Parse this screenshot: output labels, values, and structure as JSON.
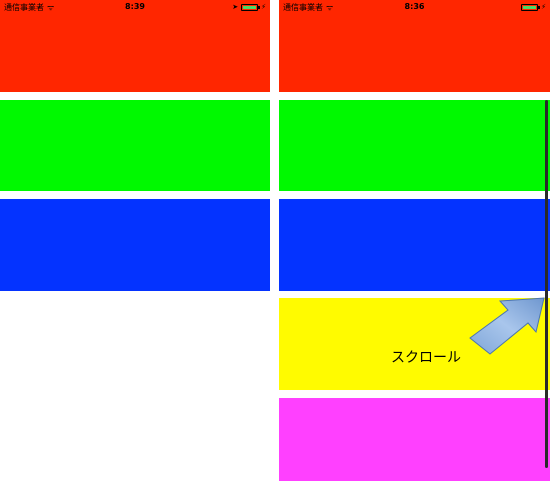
{
  "screens": [
    {
      "status": {
        "carrier": "通信事業者",
        "time": "8:39"
      },
      "bars": [
        {
          "color": "#ff2600"
        },
        {
          "color": "#00f900"
        },
        {
          "color": "#0433ff"
        }
      ]
    },
    {
      "status": {
        "carrier": "通信事業者",
        "time": "8:36"
      },
      "bars": [
        {
          "color": "#ff2600"
        },
        {
          "color": "#00f900"
        },
        {
          "color": "#0433ff"
        },
        {
          "color": "#fffb00"
        },
        {
          "color": "#ff40ff"
        }
      ],
      "annotation": {
        "label": "スクロール",
        "arrow_color": "#8db3e2"
      }
    }
  ],
  "icons": {
    "wifi": "wifi-icon",
    "location": "location-arrow-icon",
    "battery": "battery-icon",
    "charging": "bolt-icon"
  }
}
